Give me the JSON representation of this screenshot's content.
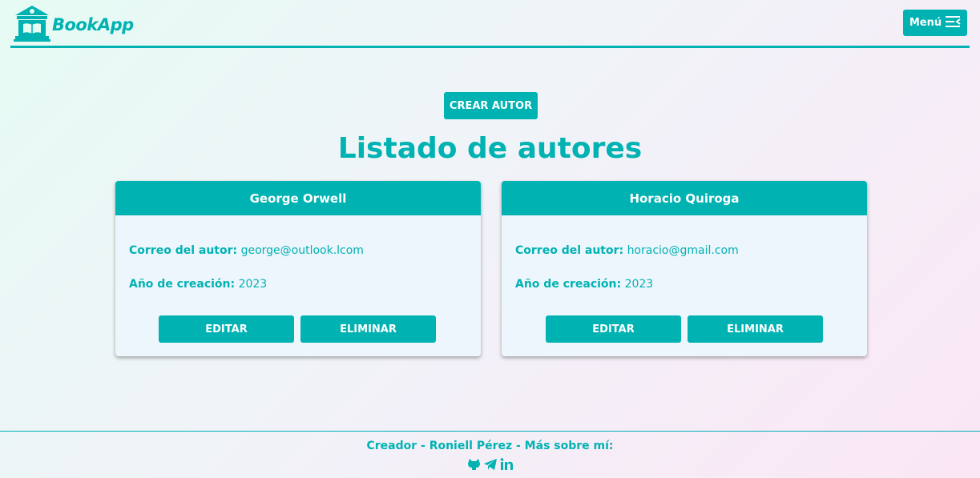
{
  "header": {
    "logo_text": "BookApp",
    "menu_label": "Menú"
  },
  "main": {
    "create_button": "CREAR AUTOR",
    "title": "Listado de autores",
    "authors": [
      {
        "name": "George Orwell",
        "email_label": "Correo del autor:",
        "email": "george@outlook.lcom",
        "year_label": "Año de creación:",
        "year": "2023",
        "edit_label": "EDITAR",
        "delete_label": "ELIMINAR"
      },
      {
        "name": "Horacio Quiroga",
        "email_label": "Correo del autor:",
        "email": "horacio@gmail.com",
        "year_label": "Año de creación:",
        "year": "2023",
        "edit_label": "EDITAR",
        "delete_label": "ELIMINAR"
      }
    ]
  },
  "footer": {
    "text": "Creador - Roniell Pérez - Más sobre mí:",
    "icons": [
      "github-icon",
      "telegram-icon",
      "linkedin-icon"
    ]
  },
  "colors": {
    "accent": "#00b2b2",
    "card_bg": "#eef6fd"
  }
}
